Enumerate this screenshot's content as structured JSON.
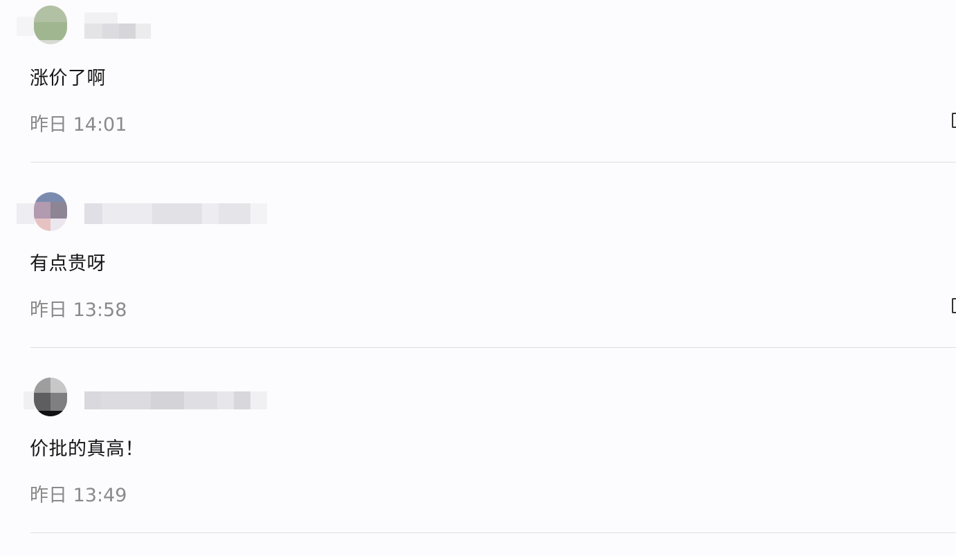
{
  "comments": [
    {
      "avatar": "blurred-avatar",
      "username_visible": false,
      "text": "涨价了啊",
      "time": "昨日 14:01"
    },
    {
      "avatar": "blurred-avatar",
      "username_visible": false,
      "text": "有点贵呀",
      "time": "昨日 13:58"
    },
    {
      "avatar": "blurred-avatar",
      "username_visible": false,
      "text": "价批的真高！",
      "time": "昨日 13:49"
    }
  ],
  "icons": {
    "reply": "comment-bubble-icon"
  },
  "colors": {
    "background": "#fcfbfd",
    "text": "#161616",
    "timestamp": "#8a8a8a",
    "divider": "#dedde2"
  }
}
